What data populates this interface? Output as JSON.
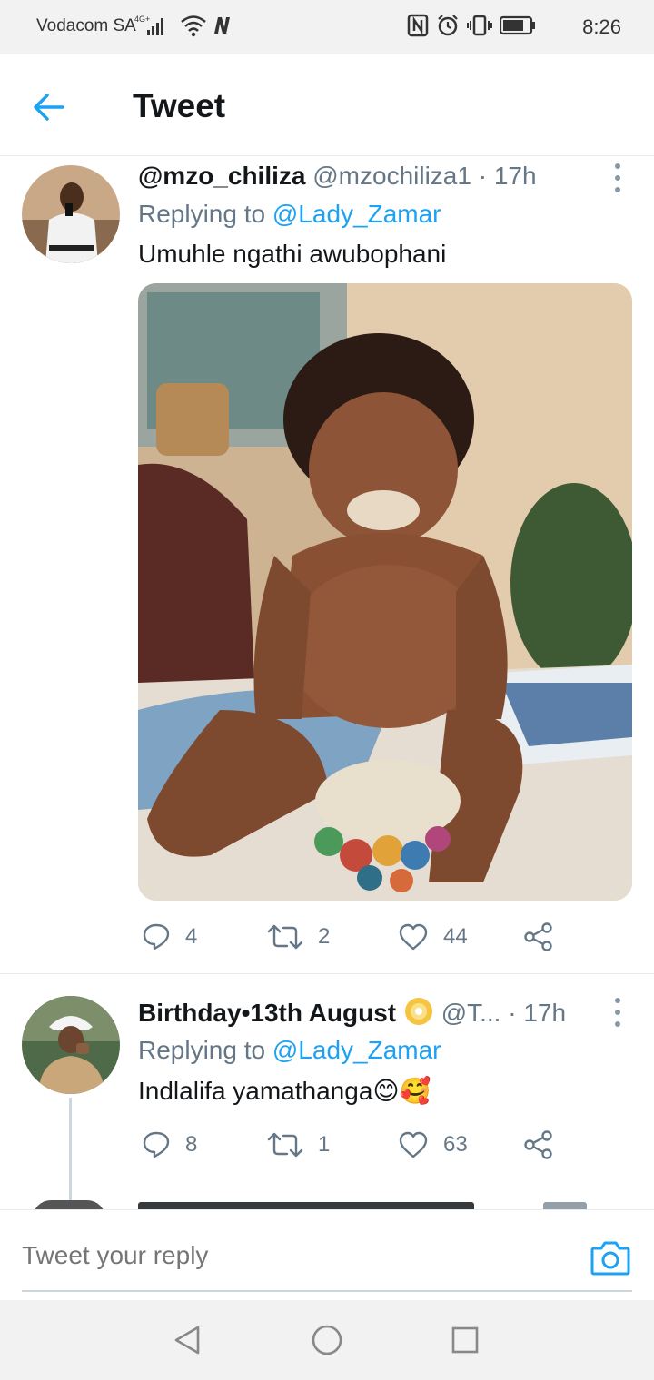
{
  "status_bar": {
    "carrier": "Vodacom SA",
    "network": "4G+",
    "time": "8:26"
  },
  "header": {
    "title": "Tweet"
  },
  "tweets": [
    {
      "name": "@mzo_chiliza",
      "handle": "@mzochiliza1",
      "time": "17h",
      "replying_label": "Replying to",
      "replying_to": "@Lady_Zamar",
      "text": "Umuhle ngathi awubophani",
      "has_image": true,
      "replies": "4",
      "retweets": "2",
      "likes": "44"
    },
    {
      "name": "Birthday•13th August",
      "handle": "@T...",
      "time": "17h",
      "replying_label": "Replying to",
      "replying_to": "@Lady_Zamar",
      "text": "Indlalifa yamathanga😊🥰",
      "has_image": false,
      "replies": "8",
      "retweets": "1",
      "likes": "63"
    }
  ],
  "reply_bar": {
    "placeholder": "Tweet your reply"
  },
  "colors": {
    "accent": "#1da1f2",
    "text": "#14171a",
    "secondary": "#657786"
  }
}
